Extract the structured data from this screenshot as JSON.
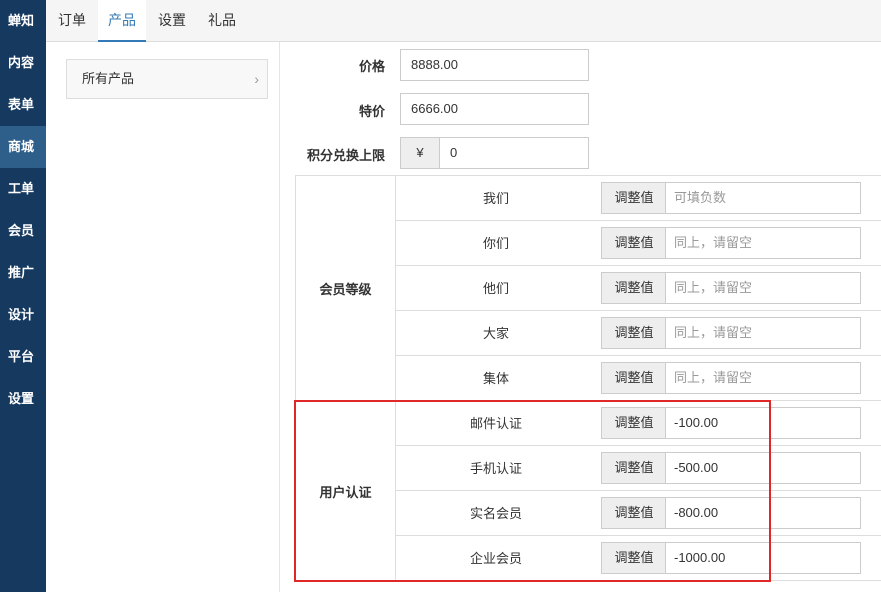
{
  "sidebar": {
    "items": [
      {
        "label": "蝉知"
      },
      {
        "label": "内容"
      },
      {
        "label": "表单"
      },
      {
        "label": "商城"
      },
      {
        "label": "工单"
      },
      {
        "label": "会员"
      },
      {
        "label": "推广"
      },
      {
        "label": "设计"
      },
      {
        "label": "平台"
      },
      {
        "label": "设置"
      }
    ]
  },
  "topbar": {
    "tabs": [
      {
        "label": "订单"
      },
      {
        "label": "产品"
      },
      {
        "label": "设置"
      },
      {
        "label": "礼品"
      }
    ]
  },
  "subnav": {
    "label": "所有产品",
    "chevron": "›"
  },
  "form": {
    "price": {
      "label": "价格",
      "value": "8888.00"
    },
    "special": {
      "label": "特价",
      "value": "6666.00"
    },
    "points": {
      "label": "积分兑换上限",
      "currency": "¥",
      "value": "0"
    }
  },
  "member_levels": {
    "label": "会员等级",
    "rows": [
      {
        "name": "我们",
        "button": "调整值",
        "placeholder": "可填负数"
      },
      {
        "name": "你们",
        "button": "调整值",
        "placeholder": "同上，请留空"
      },
      {
        "name": "他们",
        "button": "调整值",
        "placeholder": "同上，请留空"
      },
      {
        "name": "大家",
        "button": "调整值",
        "placeholder": "同上，请留空"
      },
      {
        "name": "集体",
        "button": "调整值",
        "placeholder": "同上，请留空"
      }
    ]
  },
  "user_auth": {
    "label": "用户认证",
    "rows": [
      {
        "name": "邮件认证",
        "button": "调整值",
        "value": "-100.00"
      },
      {
        "name": "手机认证",
        "button": "调整值",
        "value": "-500.00"
      },
      {
        "name": "实名会员",
        "button": "调整值",
        "value": "-800.00"
      },
      {
        "name": "企业会员",
        "button": "调整值",
        "value": "-1000.00"
      }
    ]
  },
  "colors": {
    "sidebar": "#163960",
    "active": "#2e5f8a",
    "accent": "#337ab7",
    "highlight": "#e02828"
  }
}
